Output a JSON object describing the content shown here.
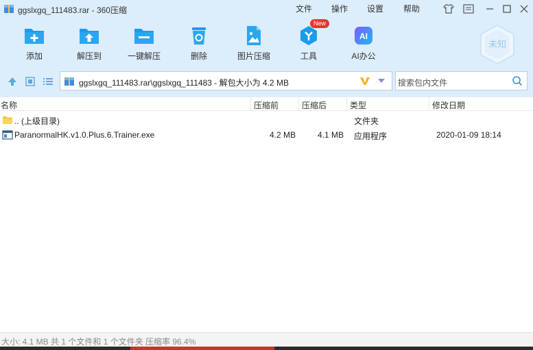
{
  "window": {
    "title": "ggslxgq_111483.rar - 360压缩",
    "menus": [
      "文件",
      "操作",
      "设置",
      "帮助"
    ]
  },
  "toolbar": {
    "items": [
      {
        "label": "添加",
        "icon": "add-archive-icon"
      },
      {
        "label": "解压到",
        "icon": "extract-to-icon"
      },
      {
        "label": "一键解压",
        "icon": "one-click-extract-icon"
      },
      {
        "label": "删除",
        "icon": "delete-icon"
      },
      {
        "label": "图片压缩",
        "icon": "image-compress-icon"
      },
      {
        "label": "工具",
        "icon": "tools-icon"
      },
      {
        "label": "AI办公",
        "icon": "ai-office-icon"
      }
    ],
    "tools_badge": "New",
    "avatar_label": "未知"
  },
  "address": {
    "path": "ggslxgq_111483.rar\\ggslxgq_111483 - 解包大小为 4.2 MB"
  },
  "search": {
    "placeholder": "搜索包内文件"
  },
  "columns": {
    "name": "名称",
    "packed": "压缩前",
    "size": "压缩后",
    "type": "类型",
    "modified": "修改日期"
  },
  "files": [
    {
      "name": ".. (上级目录)",
      "packed": "",
      "size": "",
      "type": "文件夹",
      "modified": ""
    },
    {
      "name": "ParanormalHK.v1.0.Plus.6.Trainer.exe",
      "packed": "4.2 MB",
      "size": "4.1 MB",
      "type": "应用程序",
      "modified": "2020-01-09 18:14"
    }
  ],
  "status": {
    "text": "大小: 4.1 MB 共 1 个文件和 1 个文件夹 压缩率 96.4%"
  },
  "colors": {
    "chrome_bg": "#dcedfb",
    "accent_blue": "#1e9be8",
    "badge_red": "#e8352c"
  }
}
